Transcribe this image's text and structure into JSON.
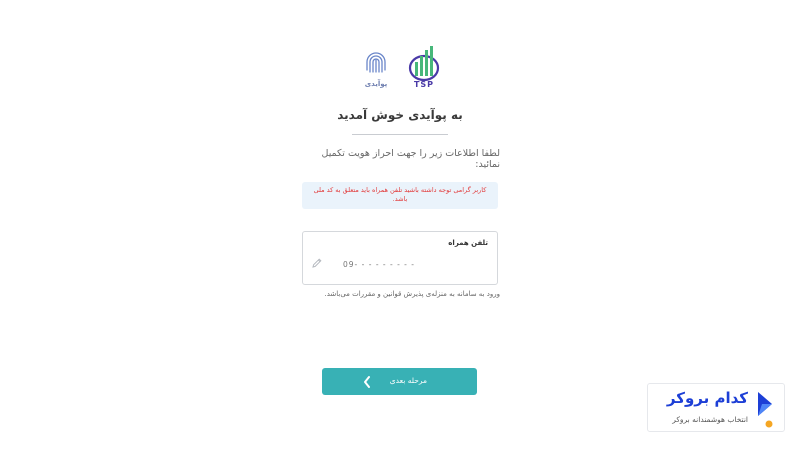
{
  "header": {
    "logo_left_caption": "پوآیدی",
    "logo_right_caption": "TSP"
  },
  "page": {
    "title": "به پوآیدی خوش آمدید",
    "subtitle": "لطفا اطلاعات زیر را جهت احراز هویت تکمیل نمائید:",
    "alert": "کاربر گرامی توجه داشته باشید تلفن همراه باید متعلق به کد ملی باشد."
  },
  "form": {
    "phone_label": "تلفن همراه",
    "phone_placeholder": "09- - - - - - - - -",
    "phone_value": ""
  },
  "terms": "ورود به سامانه به منزله‌ی پذیرش قوانین و مقررات می‌باشد.",
  "actions": {
    "next_label": "مرحله بعدی"
  },
  "watermark": {
    "title": "کدام بروکر",
    "subtitle": "انتخاب هوشمندانه بروکر"
  },
  "colors": {
    "accent": "#38b1b5",
    "alert_text": "#e23b3b",
    "alert_bg": "#eaf3fb",
    "brand_blue": "#1d3fd6"
  },
  "icons": [
    "fingerprint-icon",
    "tsp-logo-icon",
    "pencil-icon",
    "chevron-left-icon",
    "kodam-broker-logo-icon"
  ]
}
